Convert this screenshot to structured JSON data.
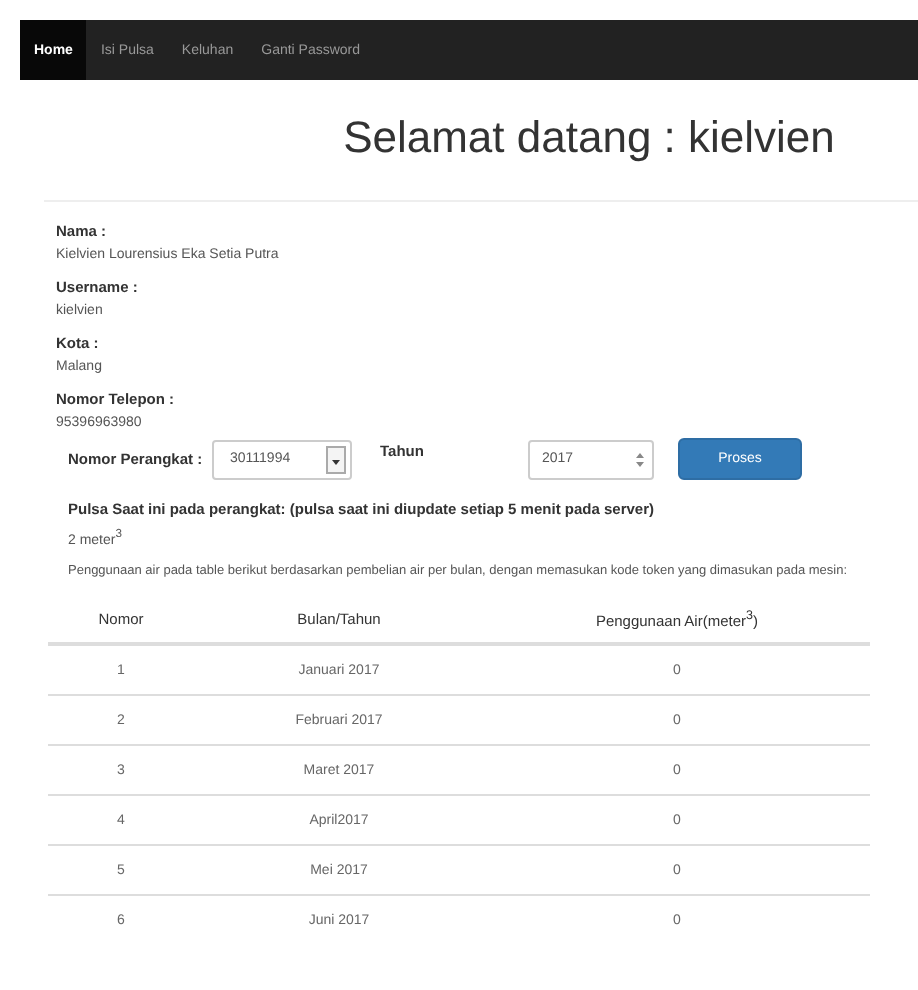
{
  "nav": [
    {
      "label": "Home",
      "selected": true
    },
    {
      "label": "Isi Pulsa",
      "selected": false
    },
    {
      "label": "Keluhan",
      "selected": false
    },
    {
      "label": "Ganti Password",
      "selected": false
    }
  ],
  "title": "Selamat datang : kielvien",
  "profile": [
    {
      "label": "Nama :",
      "value": "Kielvien Lourensius Eka Setia Putra"
    },
    {
      "label": "Username :",
      "value": "kielvien"
    },
    {
      "label": "Kota :",
      "value": "Malang"
    },
    {
      "label": "Nomor Telepon :",
      "value": "95396963980"
    }
  ],
  "form": {
    "device_label": "Nomor Perangkat :",
    "device_value": "30111994",
    "year_label": "Tahun",
    "year_value": "2017",
    "button": "Proses"
  },
  "pulse_heading": "Pulsa Saat ini pada perangkat: (pulsa saat ini diupdate setiap 5 menit pada server)",
  "pulse_value": "2 meter$^{3}$",
  "note": "Penggunaan air pada table berikut berdasarkan pembelian air per bulan, dengan memasukan kode token yang dimasukan pada mesin:",
  "table": {
    "columns": [
      "Nomor",
      "Bulan/Tahun",
      "Penggunaan Air(meter$^{3}$)"
    ],
    "rows": [
      [
        "1",
        "Januari 2017",
        "0"
      ],
      [
        "2",
        "Februari 2017",
        "0"
      ],
      [
        "3",
        "Maret 2017",
        "0"
      ],
      [
        "4",
        "April2017",
        "0"
      ],
      [
        "5",
        "Mei 2017",
        "0"
      ],
      [
        "6",
        "Juni 2017",
        "0"
      ]
    ]
  }
}
